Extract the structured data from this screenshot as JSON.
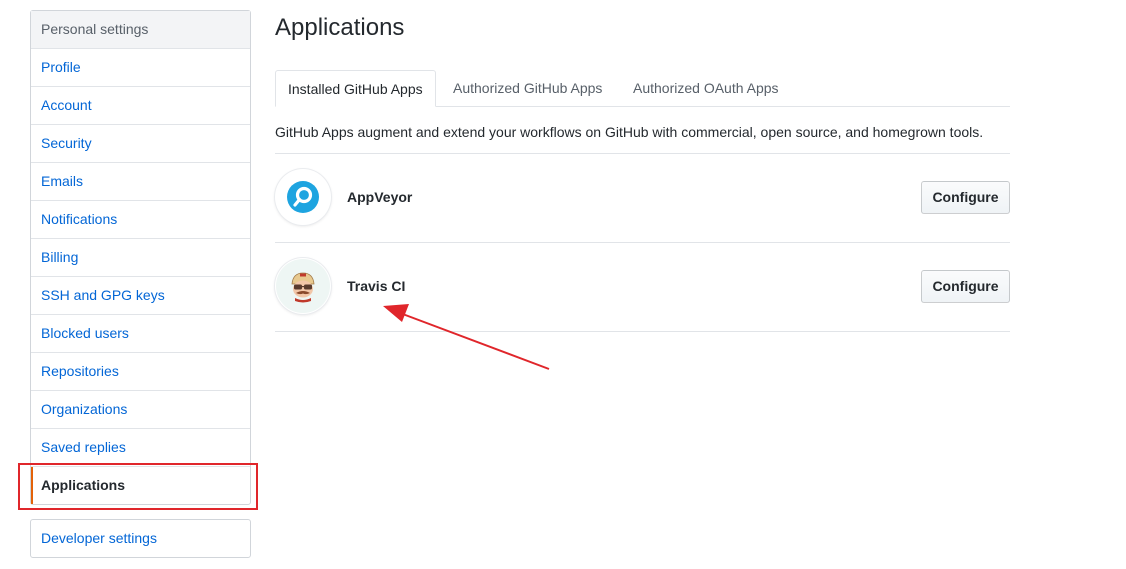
{
  "sidebar": {
    "heading": "Personal settings",
    "items": [
      {
        "label": "Profile"
      },
      {
        "label": "Account"
      },
      {
        "label": "Security"
      },
      {
        "label": "Emails"
      },
      {
        "label": "Notifications"
      },
      {
        "label": "Billing"
      },
      {
        "label": "SSH and GPG keys"
      },
      {
        "label": "Blocked users"
      },
      {
        "label": "Repositories"
      },
      {
        "label": "Organizations"
      },
      {
        "label": "Saved replies"
      },
      {
        "label": "Applications"
      }
    ],
    "developer_settings": "Developer settings"
  },
  "main": {
    "title": "Applications",
    "tabs": [
      {
        "label": "Installed GitHub Apps"
      },
      {
        "label": "Authorized GitHub Apps"
      },
      {
        "label": "Authorized OAuth Apps"
      }
    ],
    "intro": "GitHub Apps augment and extend your workflows on GitHub with commercial, open source, and homegrown tools.",
    "apps": [
      {
        "name": "AppVeyor",
        "button": "Configure",
        "icon": "appveyor-logo-icon"
      },
      {
        "name": "Travis CI",
        "button": "Configure",
        "icon": "travis-ci-mascot-icon"
      }
    ]
  },
  "colors": {
    "link": "#0366d6",
    "selected_indicator": "#e36209",
    "annotation_red": "#e0262b",
    "appveyor_blue": "#1ea4e0"
  }
}
